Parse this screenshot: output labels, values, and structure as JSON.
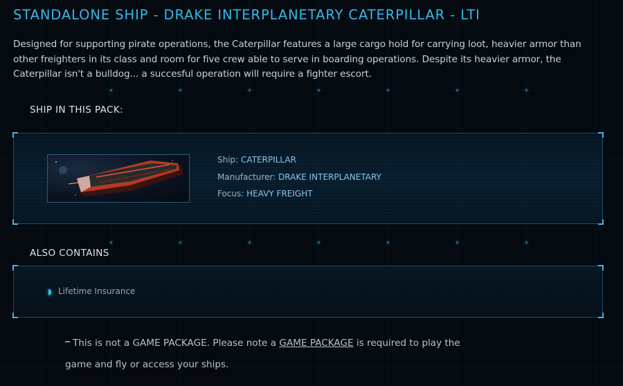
{
  "title": "STANDALONE SHIP - DRAKE INTERPLANETARY CATERPILLAR - LTI",
  "description": "Designed for supporting pirate operations, the Caterpillar features a large cargo hold for carrying loot, heavier armor than other freighters in its class and room for five crew able to serve in boarding operations. Despite its heavier armor, the Caterpillar isn't a bulldog... a succesful operation will require a fighter escort.",
  "ship_section": {
    "label": "SHIP IN THIS PACK:",
    "ship": {
      "ship_label": "Ship:",
      "ship_value": "CATERPILLAR",
      "manufacturer_label": "Manufacturer:",
      "manufacturer_value": "DRAKE INTERPLANETARY",
      "focus_label": "Focus:",
      "focus_value": "HEAVY FREIGHT"
    }
  },
  "contains_section": {
    "label": "ALSO CONTAINS",
    "items": [
      "Lifetime Insurance"
    ]
  },
  "note": {
    "text_before": "This is not a GAME PACKAGE. Please note a ",
    "link_text": "GAME PACKAGE",
    "text_after": " is required to play the game and fly or access your ships."
  },
  "colors": {
    "accent": "#37b8e6",
    "background": "#040a10",
    "value_text": "#8ac6ec"
  }
}
